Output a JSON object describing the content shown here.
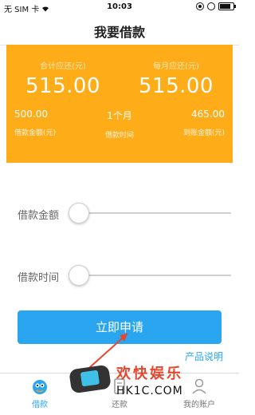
{
  "status_bar": {
    "carrier": "无 SIM 卡",
    "time": "10:03",
    "battery_level": 0.8
  },
  "nav": {
    "title": "我要借款"
  },
  "summary": {
    "total_label": "合计应还(元)",
    "total_value": "515.00",
    "monthly_label": "每月应还(元)",
    "monthly_value": "515.00",
    "details": [
      {
        "value": "500.00",
        "label": "借款金额(元)"
      },
      {
        "value": "1个月",
        "label": "借款时间"
      },
      {
        "value": "465.00",
        "label": "到账金额(元)"
      }
    ],
    "bg_color": "#ffac19"
  },
  "sliders": {
    "amount_label": "借款金额",
    "amount_level": 0,
    "time_label": "借款时间",
    "time_level": 0
  },
  "apply_button": {
    "label": "立即申请",
    "color": "#2aa6f0"
  },
  "product_link": {
    "label": "产品说明"
  },
  "tabs": [
    {
      "label": "借款",
      "icon": "mascot-icon",
      "active": true
    },
    {
      "label": "还款",
      "icon": "receipt-icon",
      "active": false
    },
    {
      "label": "我的账户",
      "icon": "user-icon",
      "active": false
    }
  ],
  "watermark": {
    "title": "欢快娱乐",
    "url": "HK1C.COM"
  }
}
